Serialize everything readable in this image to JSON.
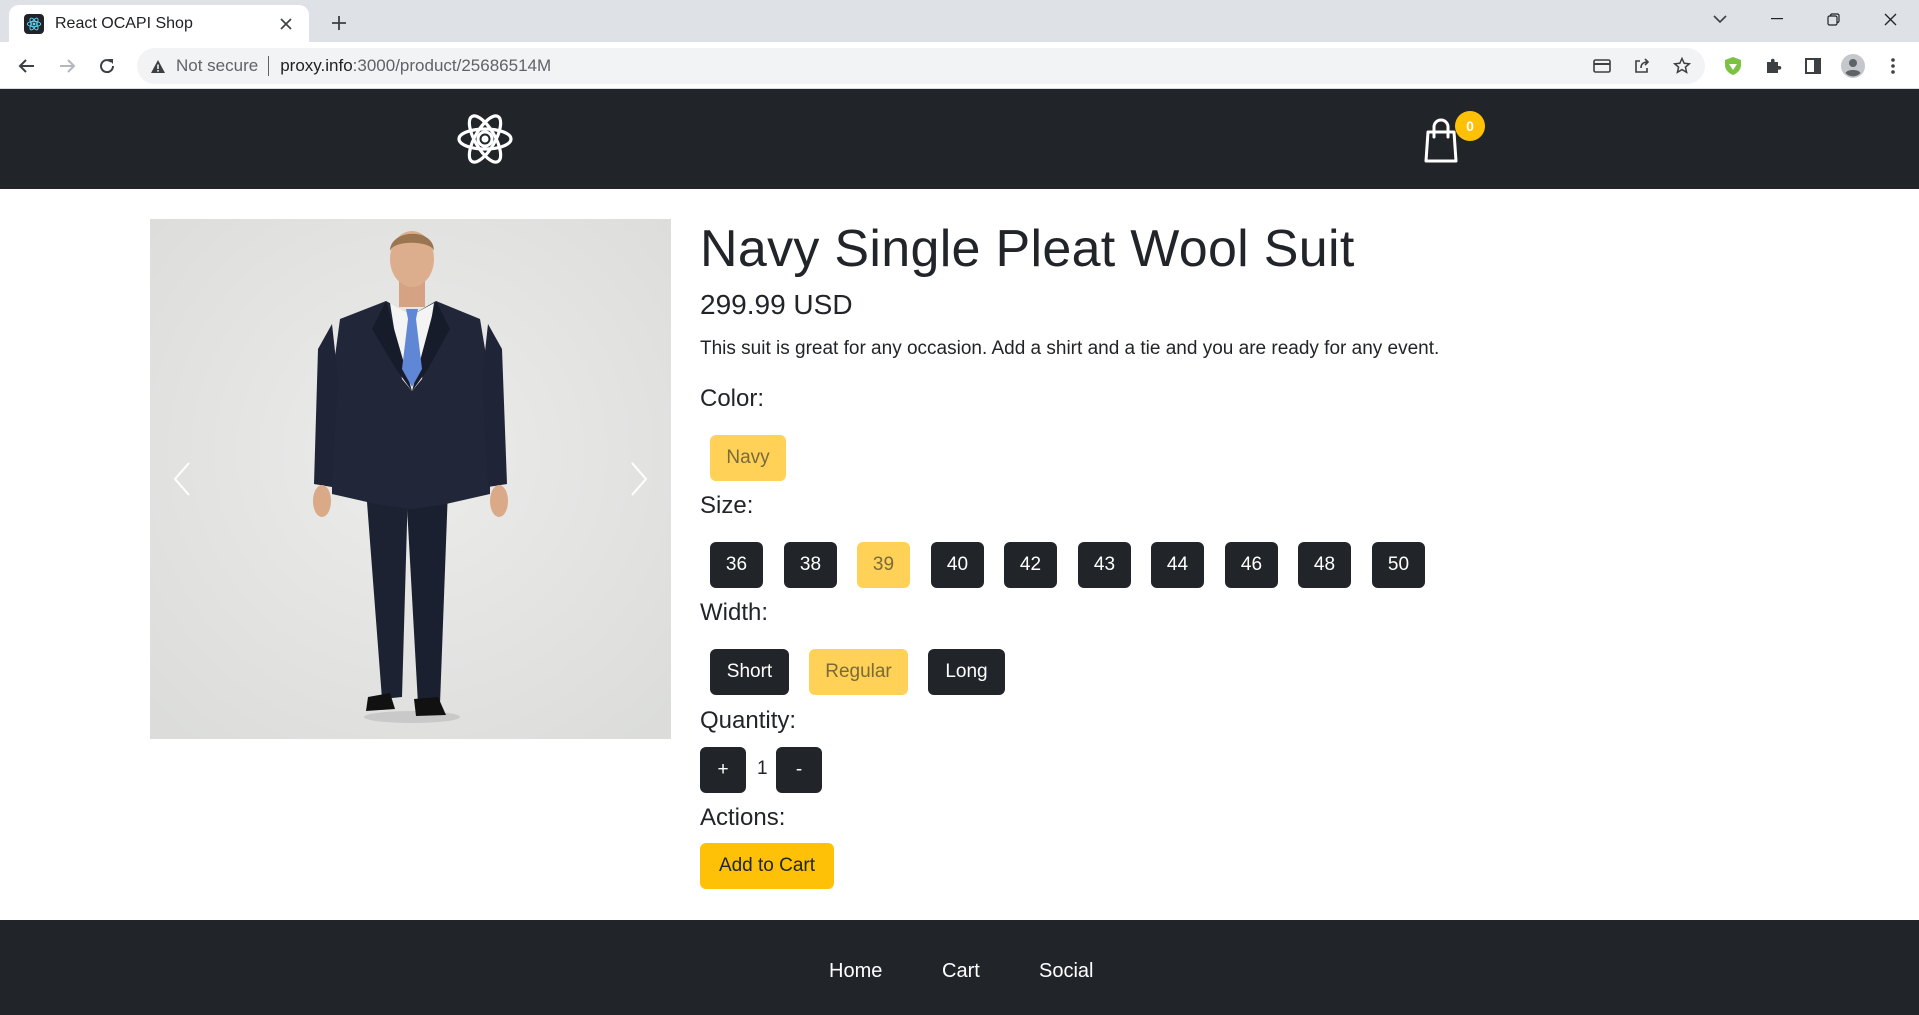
{
  "browser": {
    "tab_title": "React OCAPI Shop",
    "security_label": "Not secure",
    "url_host": "proxy.info",
    "url_path": ":3000/product/25686514M"
  },
  "header": {
    "cart_count": "0"
  },
  "product": {
    "title": "Navy Single Pleat Wool Suit",
    "price": "299.99 USD",
    "description": "This suit is great for any occasion. Add a shirt and a tie and you are ready for any event.",
    "color_label": "Color:",
    "colors": [
      {
        "label": "Navy",
        "selected": true
      }
    ],
    "size_label": "Size:",
    "sizes": [
      {
        "label": "36",
        "selected": false
      },
      {
        "label": "38",
        "selected": false
      },
      {
        "label": "39",
        "selected": true
      },
      {
        "label": "40",
        "selected": false
      },
      {
        "label": "42",
        "selected": false
      },
      {
        "label": "43",
        "selected": false
      },
      {
        "label": "44",
        "selected": false
      },
      {
        "label": "46",
        "selected": false
      },
      {
        "label": "48",
        "selected": false
      },
      {
        "label": "50",
        "selected": false
      }
    ],
    "width_label": "Width:",
    "widths": [
      {
        "label": "Short",
        "selected": false
      },
      {
        "label": "Regular",
        "selected": true
      },
      {
        "label": "Long",
        "selected": false
      }
    ],
    "quantity_label": "Quantity:",
    "quantity_plus": "+",
    "quantity_value": "1",
    "quantity_minus": "-",
    "actions_label": "Actions:",
    "add_to_cart": "Add to Cart"
  },
  "footer": {
    "links": [
      "Home",
      "Cart",
      "Social"
    ]
  },
  "colors": {
    "dark": "#212529",
    "accent": "#ffc107",
    "selected": "#ffd257"
  }
}
